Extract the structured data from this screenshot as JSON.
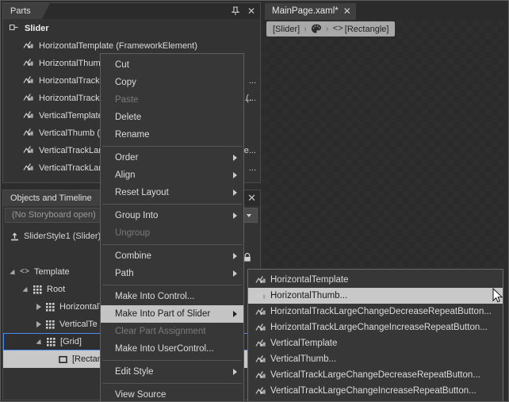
{
  "parts_panel": {
    "tab_label": "Parts",
    "pin_icon": "pin-icon",
    "close_icon": "close-icon",
    "root": {
      "label": "Slider",
      "icon": "control-icon"
    },
    "items": [
      {
        "label": "HorizontalTemplate (FrameworkElement)",
        "icon": "part-icon",
        "overflow": ""
      },
      {
        "label": "HorizontalThumb (Thumb)",
        "icon": "part-icon",
        "overflow": ""
      },
      {
        "label": "HorizontalTrackLargeChangeDecreaseRepeatButton",
        "icon": "part-icon",
        "overflow": "..."
      },
      {
        "label": "HorizontalTrackLargeChangeIncreaseRepeatButton (...",
        "icon": "part-icon",
        "overflow": "(..."
      },
      {
        "label": "VerticalTemplate (FrameworkElement)",
        "icon": "part-icon",
        "overflow": ""
      },
      {
        "label": "VerticalThumb (Thumb)",
        "icon": "part-icon",
        "overflow": ""
      },
      {
        "label": "VerticalTrackLargeChangeDecreaseRepeatButton",
        "icon": "part-icon",
        "overflow": "e..."
      },
      {
        "label": "VerticalTrackLargeChangeIncreaseRepeatButton",
        "icon": "part-icon",
        "overflow": "..."
      }
    ]
  },
  "objects_panel": {
    "tab_label": "Objects and Timeline",
    "close_icon": "close-icon",
    "storyboard_text": "(No Storyboard open)",
    "storyboard_dropdown_icon": "chevron-down-icon",
    "style_row": {
      "label": "SliderStyle1 (Slider)",
      "icon": "style-scope-icon"
    },
    "lock_icon": "lock-icon",
    "eye_icon": "eye-icon",
    "tree": [
      {
        "label": "Template",
        "indent": 0,
        "twisty": "down",
        "icon": "template-icon",
        "state": "normal"
      },
      {
        "label": "Root",
        "indent": 1,
        "twisty": "down",
        "icon": "grid-icon",
        "state": "normal"
      },
      {
        "label": "HorizontalTe",
        "indent": 2,
        "twisty": "right",
        "icon": "grid-icon",
        "state": "normal"
      },
      {
        "label": "VerticalTe",
        "indent": 2,
        "twisty": "right",
        "icon": "grid-icon",
        "state": "normal"
      },
      {
        "label": "[Grid]",
        "indent": 2,
        "twisty": "down",
        "icon": "grid-icon",
        "state": "selected"
      },
      {
        "label": "[Rectangle]",
        "indent": 3,
        "twisty": "none",
        "icon": "rectangle-icon",
        "state": "highlight"
      }
    ]
  },
  "document": {
    "tab_label": "MainPage.xaml*",
    "tab_close_icon": "close-icon",
    "breadcrumb": [
      {
        "type": "text",
        "label": "[Slider]"
      },
      {
        "type": "sep",
        "label": "›"
      },
      {
        "type": "icon",
        "label": "palette-icon"
      },
      {
        "type": "sep",
        "label": "›"
      },
      {
        "type": "icon",
        "label": "code-brackets-icon"
      },
      {
        "type": "text",
        "label": "[Rectangle]"
      }
    ]
  },
  "context_menu": {
    "items": [
      {
        "label": "Cut",
        "state": "normal",
        "submenu": false
      },
      {
        "label": "Copy",
        "state": "normal",
        "submenu": false
      },
      {
        "label": "Paste",
        "state": "disabled",
        "submenu": false
      },
      {
        "label": "Delete",
        "state": "normal",
        "submenu": false
      },
      {
        "label": "Rename",
        "state": "normal",
        "submenu": false
      },
      {
        "label": "__SEP__",
        "state": "sep",
        "submenu": false
      },
      {
        "label": "Order",
        "state": "normal",
        "submenu": true
      },
      {
        "label": "Align",
        "state": "normal",
        "submenu": true
      },
      {
        "label": "Reset Layout",
        "state": "normal",
        "submenu": true
      },
      {
        "label": "__SEP__",
        "state": "sep",
        "submenu": false
      },
      {
        "label": "Group Into",
        "state": "normal",
        "submenu": true
      },
      {
        "label": "Ungroup",
        "state": "disabled",
        "submenu": false
      },
      {
        "label": "__SEP__",
        "state": "sep",
        "submenu": false
      },
      {
        "label": "Combine",
        "state": "normal",
        "submenu": true
      },
      {
        "label": "Path",
        "state": "normal",
        "submenu": true
      },
      {
        "label": "__SEP__",
        "state": "sep",
        "submenu": false
      },
      {
        "label": "Make Into Control...",
        "state": "normal",
        "submenu": false
      },
      {
        "label": "Make Into Part of Slider",
        "state": "active",
        "submenu": true
      },
      {
        "label": "Clear Part Assignment",
        "state": "disabled",
        "submenu": false
      },
      {
        "label": "Make Into UserControl...",
        "state": "normal",
        "submenu": false
      },
      {
        "label": "__SEP__",
        "state": "sep",
        "submenu": false
      },
      {
        "label": "Edit Style",
        "state": "normal",
        "submenu": true
      },
      {
        "label": "__SEP__",
        "state": "sep",
        "submenu": false
      },
      {
        "label": "View Source",
        "state": "normal",
        "submenu": false
      }
    ]
  },
  "submenu": {
    "items": [
      {
        "label": "HorizontalTemplate",
        "icon": "part-icon",
        "state": "normal"
      },
      {
        "label": "HorizontalThumb...",
        "icon": "part-icon",
        "state": "active"
      },
      {
        "label": "HorizontalTrackLargeChangeDecreaseRepeatButton...",
        "icon": "part-icon",
        "state": "normal"
      },
      {
        "label": "HorizontalTrackLargeChangeIncreaseRepeatButton...",
        "icon": "part-icon",
        "state": "normal"
      },
      {
        "label": "VerticalTemplate",
        "icon": "part-icon",
        "state": "normal"
      },
      {
        "label": "VerticalThumb...",
        "icon": "part-icon",
        "state": "normal"
      },
      {
        "label": "VerticalTrackLargeChangeDecreaseRepeatButton...",
        "icon": "part-icon",
        "state": "normal"
      },
      {
        "label": "VerticalTrackLargeChangeIncreaseRepeatButton...",
        "icon": "part-icon",
        "state": "normal"
      }
    ]
  },
  "cursor": {
    "icon": "mouse-pointer-icon"
  },
  "colors": {
    "panel_bg": "#333333",
    "app_bg": "#2d2d2d",
    "menu_bg": "#373737",
    "highlight": "#c8c8c8",
    "selection_outline": "#4a8cf7",
    "text": "#dcdcdc",
    "text_disabled": "#7a7a7a"
  }
}
